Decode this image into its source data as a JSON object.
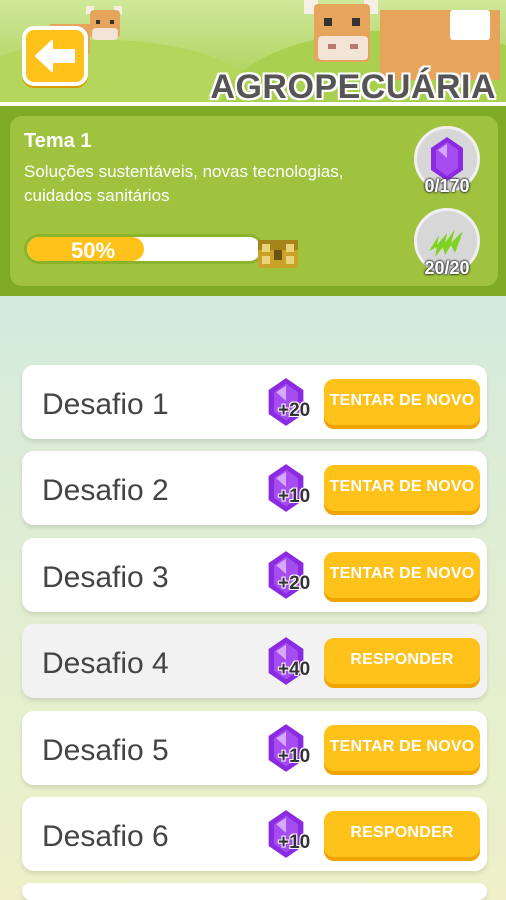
{
  "header": {
    "title": "AGROPECUÁRIA",
    "back_icon": "arrow-left-icon"
  },
  "theme": {
    "title": "Tema 1",
    "description": "Soluções sustentáveis, novas tecnologias, cuidados sanitários",
    "progress_label": "50%",
    "progress_value": 50,
    "gems": "0/170",
    "energy": "20/20"
  },
  "challenges": [
    {
      "name": "Desafio 1",
      "points": "+20",
      "action": "TENTAR DE NOVO"
    },
    {
      "name": "Desafio 2",
      "points": "+10",
      "action": "TENTAR DE NOVO"
    },
    {
      "name": "Desafio 3",
      "points": "+20",
      "action": "TENTAR DE NOVO"
    },
    {
      "name": "Desafio 4",
      "points": "+40",
      "action": "RESPONDER"
    },
    {
      "name": "Desafio 5",
      "points": "+10",
      "action": "TENTAR DE NOVO"
    },
    {
      "name": "Desafio 6",
      "points": "+10",
      "action": "RESPONDER"
    }
  ],
  "colors": {
    "accent_yellow": "#ffc21a",
    "header_green": "#7faa26",
    "gem_purple": "#8a2be2"
  }
}
